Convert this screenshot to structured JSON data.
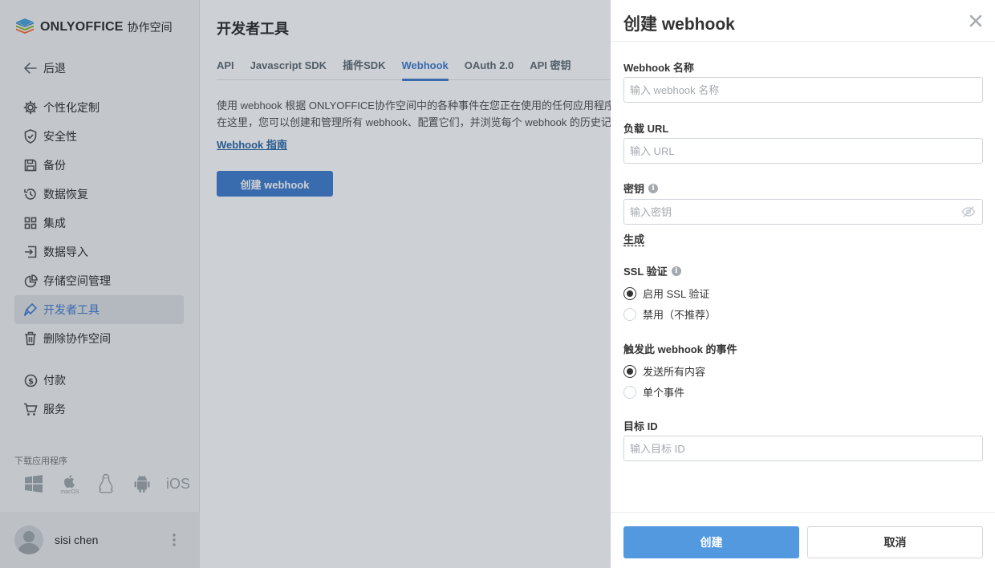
{
  "app": {
    "brand": "ONLYOFFICE",
    "brand_sub": "协作空间"
  },
  "sidebar": {
    "back_label": "后退",
    "items": [
      {
        "label": "个性化定制",
        "icon": "gear-icon"
      },
      {
        "label": "安全性",
        "icon": "shield-icon"
      },
      {
        "label": "备份",
        "icon": "save-icon"
      },
      {
        "label": "数据恢复",
        "icon": "restore-icon"
      },
      {
        "label": "集成",
        "icon": "grid-icon"
      },
      {
        "label": "数据导入",
        "icon": "import-icon"
      },
      {
        "label": "存储空间管理",
        "icon": "pie-icon"
      },
      {
        "label": "开发者工具",
        "icon": "developer-icon",
        "active": true
      },
      {
        "label": "删除协作空间",
        "icon": "trash-icon"
      }
    ],
    "items2": [
      {
        "label": "付款",
        "icon": "dollar-icon"
      },
      {
        "label": "服务",
        "icon": "cart-icon"
      }
    ],
    "download_title": "下载应用程序",
    "apps": [
      "windows-icon",
      "macos-icon",
      "linux-icon",
      "android-icon",
      "ios-icon"
    ],
    "macos_label": "macOS",
    "ios_label": "iOS",
    "user_name": "sisi chen"
  },
  "main": {
    "title": "开发者工具",
    "tabs": [
      "API",
      "Javascript SDK",
      "插件SDK",
      "Webhook",
      "OAuth 2.0",
      "API 密钥"
    ],
    "active_tab": "Webhook",
    "desc_line1": "使用 webhook 根据 ONLYOFFICE协作空间中的各种事件在您正在使用的任何应用程序",
    "desc_line2": "在这里，您可以创建和管理所有 webhook、配置它们，并浏览每个 webhook 的历史记",
    "guide_link": "Webhook 指南",
    "create_button": "创建 webhook"
  },
  "panel": {
    "title": "创建 webhook",
    "name_label": "Webhook 名称",
    "name_placeholder": "输入 webhook 名称",
    "url_label": "负载 URL",
    "url_placeholder": "输入 URL",
    "secret_label": "密钥",
    "secret_placeholder": "输入密钥",
    "generate_label": "生成",
    "ssl_label": "SSL 验证",
    "ssl_enable": "启用 SSL 验证",
    "ssl_disable": "禁用（不推荐）",
    "events_label": "触发此 webhook 的事件",
    "events_all": "发送所有内容",
    "events_single": "单个事件",
    "target_label": "目标 ID",
    "target_placeholder": "输入目标 ID",
    "create_label": "创建",
    "cancel_label": "取消"
  },
  "colors": {
    "accent": "#4781d1",
    "primary_button": "#5299e0"
  }
}
